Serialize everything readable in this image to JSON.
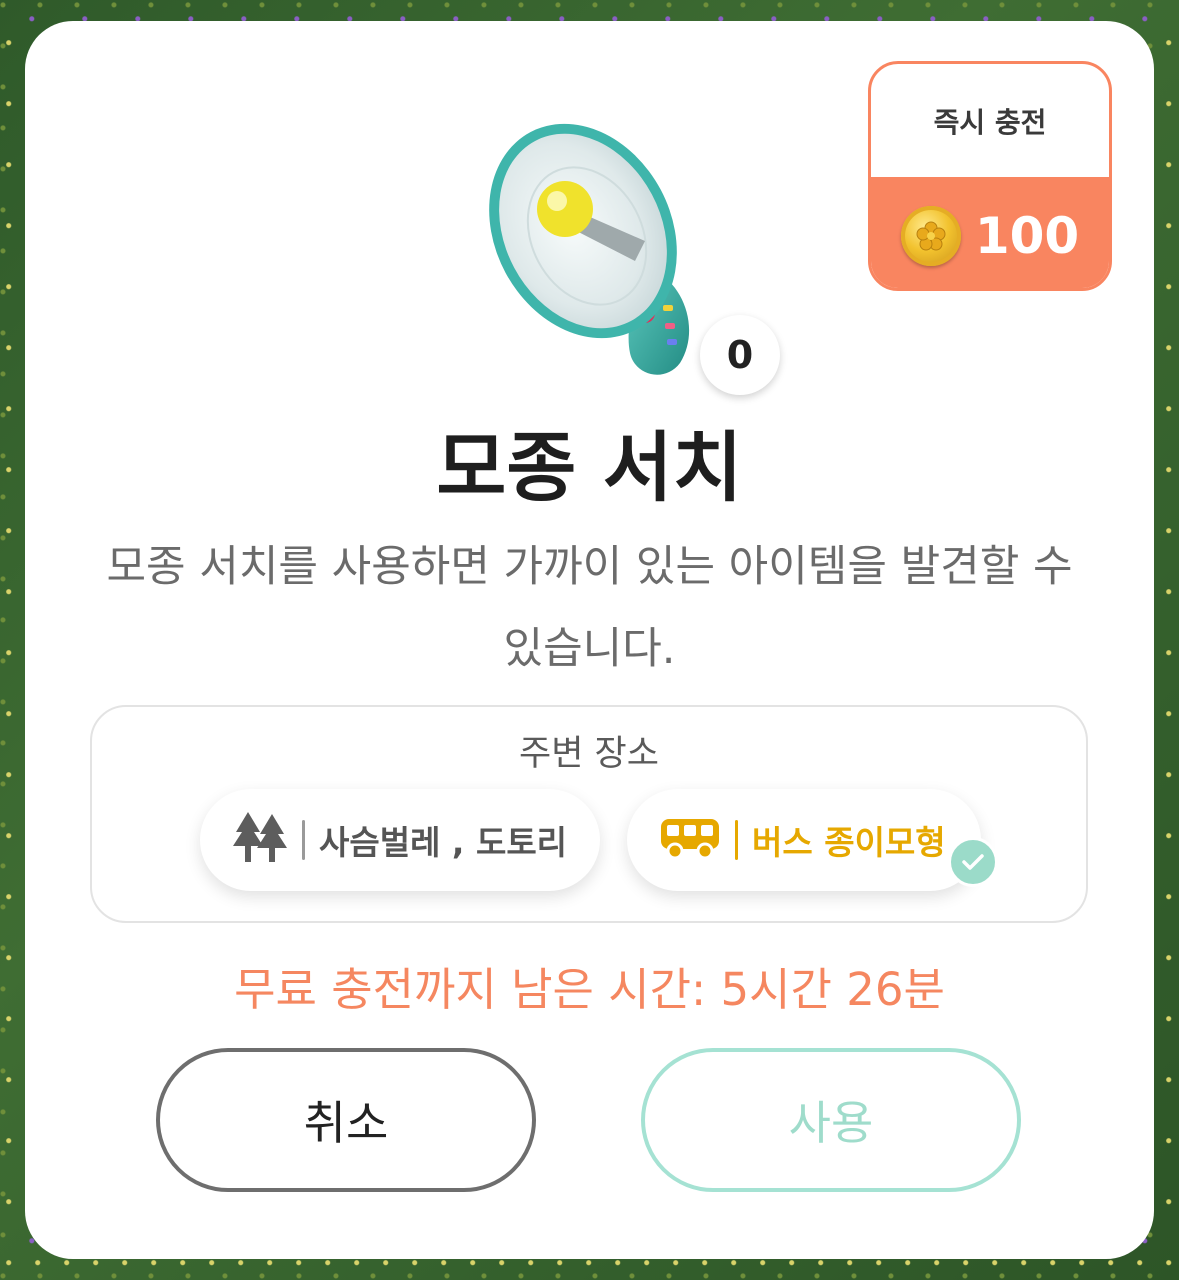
{
  "charge": {
    "label": "즉시 충전",
    "amount": "100",
    "coin_icon": "gold-coin-icon",
    "accent": "#f98560"
  },
  "item": {
    "icon": "megaphone-icon",
    "count": "0",
    "title": "모종 서치"
  },
  "description": "모종 서치를 사용하면 가까이 있는 아이템을  발견할 수 있습니다.",
  "nearby": {
    "label": "주변 장소",
    "places": [
      {
        "icon": "trees-icon",
        "text": "사슴벌레 , 도토리",
        "color": "#555555"
      },
      {
        "icon": "bus-icon",
        "text": "버스 종이모형",
        "color": "#e6a800",
        "checked": true
      }
    ]
  },
  "timer_text": "무료 충전까지 남은 시간: 5시간 26분",
  "buttons": {
    "cancel": "취소",
    "use": "사용"
  }
}
